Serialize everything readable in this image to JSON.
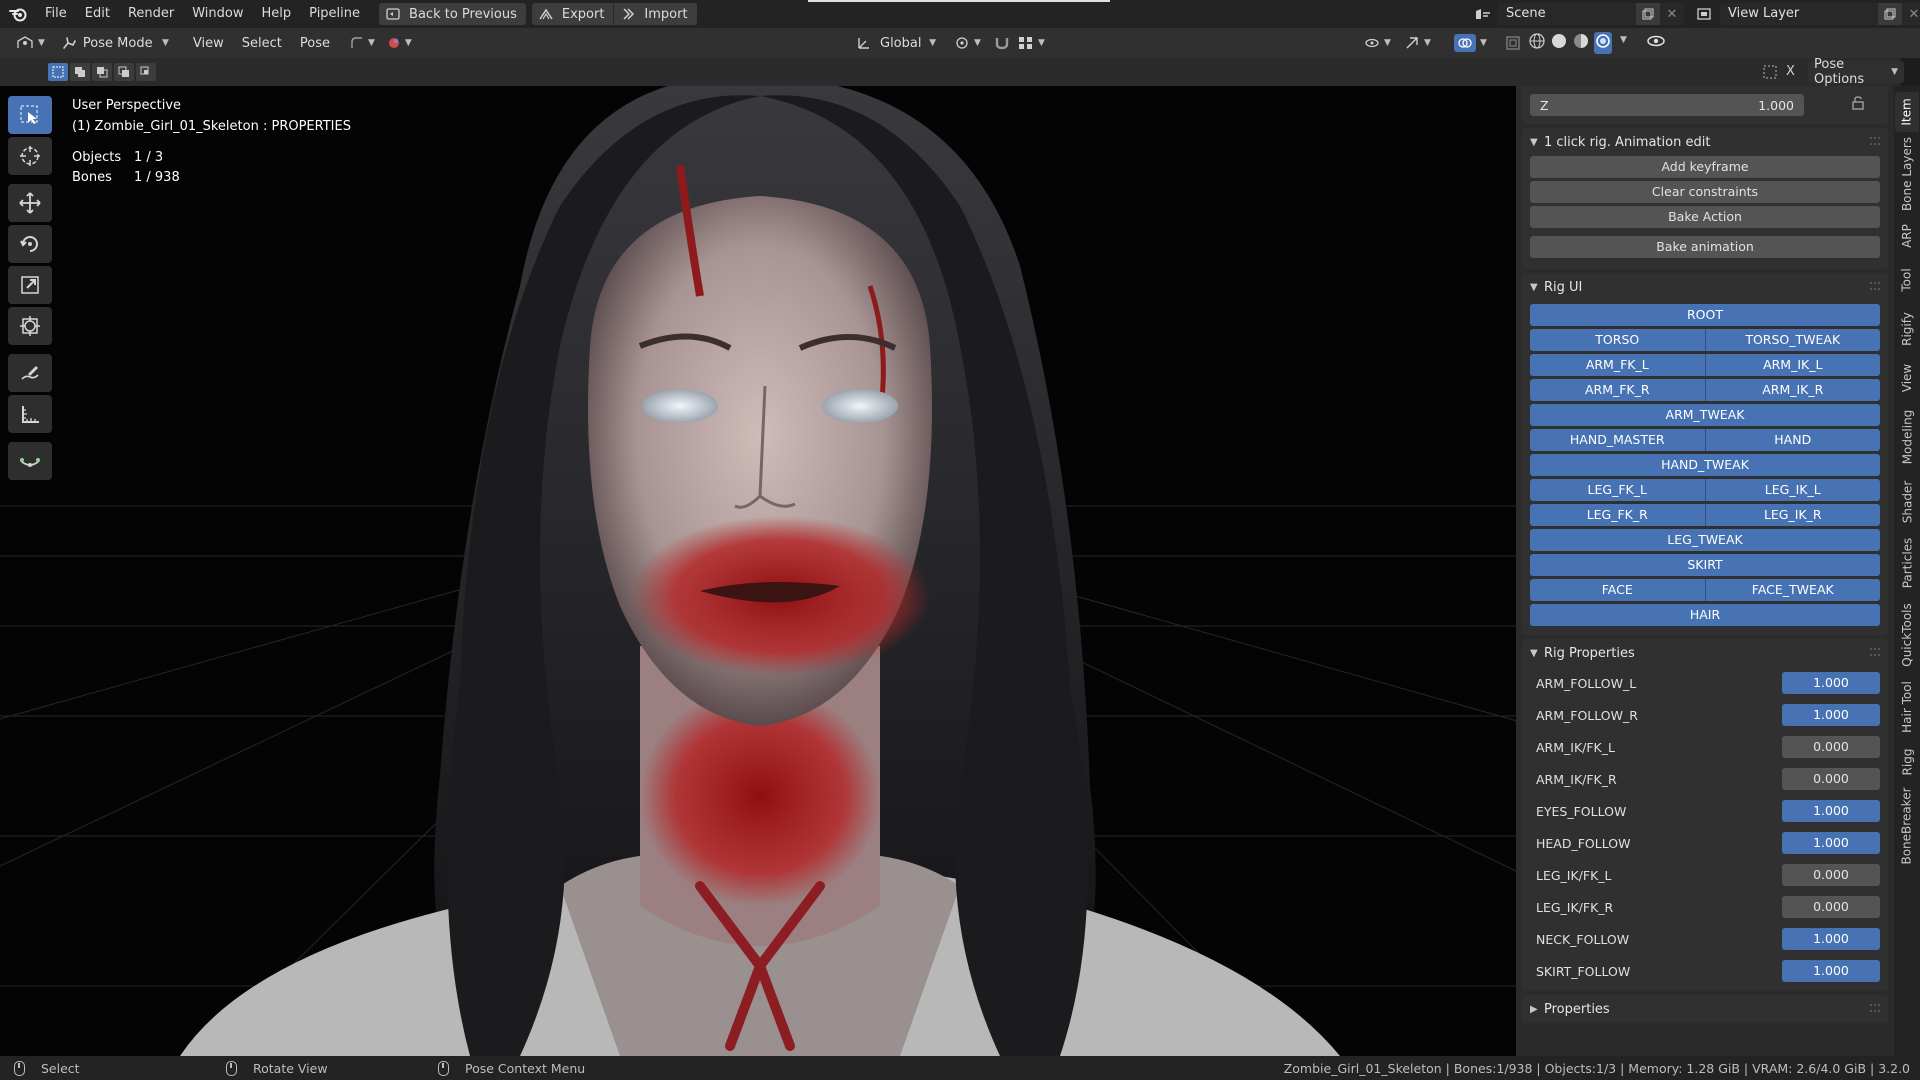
{
  "menubar": {
    "items": [
      "File",
      "Edit",
      "Render",
      "Window",
      "Help",
      "Pipeline"
    ],
    "back_to_previous": "Back to Previous",
    "export": "Export",
    "import": "Import",
    "scene": "Scene",
    "view_layer": "View Layer"
  },
  "header": {
    "mode": "Pose Mode",
    "menus": [
      "View",
      "Select",
      "Pose"
    ],
    "transform_orientation": "Global",
    "pose_options": "Pose Options"
  },
  "viewport": {
    "perspective": "User Perspective",
    "active_object": "(1) Zombie_Girl_01_Skeleton : PROPERTIES",
    "stats": [
      {
        "label": "Objects",
        "value": "1 / 3"
      },
      {
        "label": "Bones",
        "value": "1 / 938"
      }
    ]
  },
  "sidebar": {
    "z_field": {
      "label": "Z",
      "value": "1.000"
    },
    "animation_panel": {
      "title": "1 click rig. Animation edit",
      "buttons": [
        "Add keyframe",
        "Clear constraints",
        "Bake Action",
        "Bake animation"
      ]
    },
    "rig_ui": {
      "title": "Rig UI",
      "rows": [
        [
          "ROOT"
        ],
        [
          "TORSO",
          "TORSO_TWEAK"
        ],
        [
          "ARM_FK_L",
          "ARM_IK_L"
        ],
        [
          "ARM_FK_R",
          "ARM_IK_R"
        ],
        [
          "ARM_TWEAK"
        ],
        [
          "HAND_MASTER",
          "HAND"
        ],
        [
          "HAND_TWEAK"
        ],
        [
          "LEG_FK_L",
          "LEG_IK_L"
        ],
        [
          "LEG_FK_R",
          "LEG_IK_R"
        ],
        [
          "LEG_TWEAK"
        ],
        [
          "SKIRT"
        ],
        [
          "FACE",
          "FACE_TWEAK"
        ],
        [
          "HAIR"
        ]
      ]
    },
    "rig_properties": {
      "title": "Rig Properties",
      "props": [
        {
          "name": "ARM_FOLLOW_L",
          "value": "1.000",
          "on": true
        },
        {
          "name": "ARM_FOLLOW_R",
          "value": "1.000",
          "on": true
        },
        {
          "name": "ARM_IK/FK_L",
          "value": "0.000",
          "on": false
        },
        {
          "name": "ARM_IK/FK_R",
          "value": "0.000",
          "on": false
        },
        {
          "name": "EYES_FOLLOW",
          "value": "1.000",
          "on": true
        },
        {
          "name": "HEAD_FOLLOW",
          "value": "1.000",
          "on": true
        },
        {
          "name": "LEG_IK/FK_L",
          "value": "0.000",
          "on": false
        },
        {
          "name": "LEG_IK/FK_R",
          "value": "0.000",
          "on": false
        },
        {
          "name": "NECK_FOLLOW",
          "value": "1.000",
          "on": true
        },
        {
          "name": "SKIRT_FOLLOW",
          "value": "1.000",
          "on": true
        }
      ]
    },
    "properties_panel": {
      "title": "Properties"
    }
  },
  "vtabs": [
    "Item",
    "Bone Layers",
    "ARP",
    "Tool",
    "Rigify",
    "View",
    "Modeling",
    "Shader",
    "Particles",
    "QuickTools",
    "Hair Tool",
    "Rigg",
    "BoneBreaker"
  ],
  "statusbar": {
    "select": "Select",
    "rotate_view": "Rotate View",
    "context_menu": "Pose Context Menu",
    "info": "Zombie_Girl_01_Skeleton | Bones:1/938 | Objects:1/3 | Memory: 1.28 GiB | VRAM: 2.6/4.0 GiB | 3.2.0"
  },
  "colors": {
    "accent": "#4772b3",
    "panel": "#303030",
    "background": "#1d1d1d"
  }
}
